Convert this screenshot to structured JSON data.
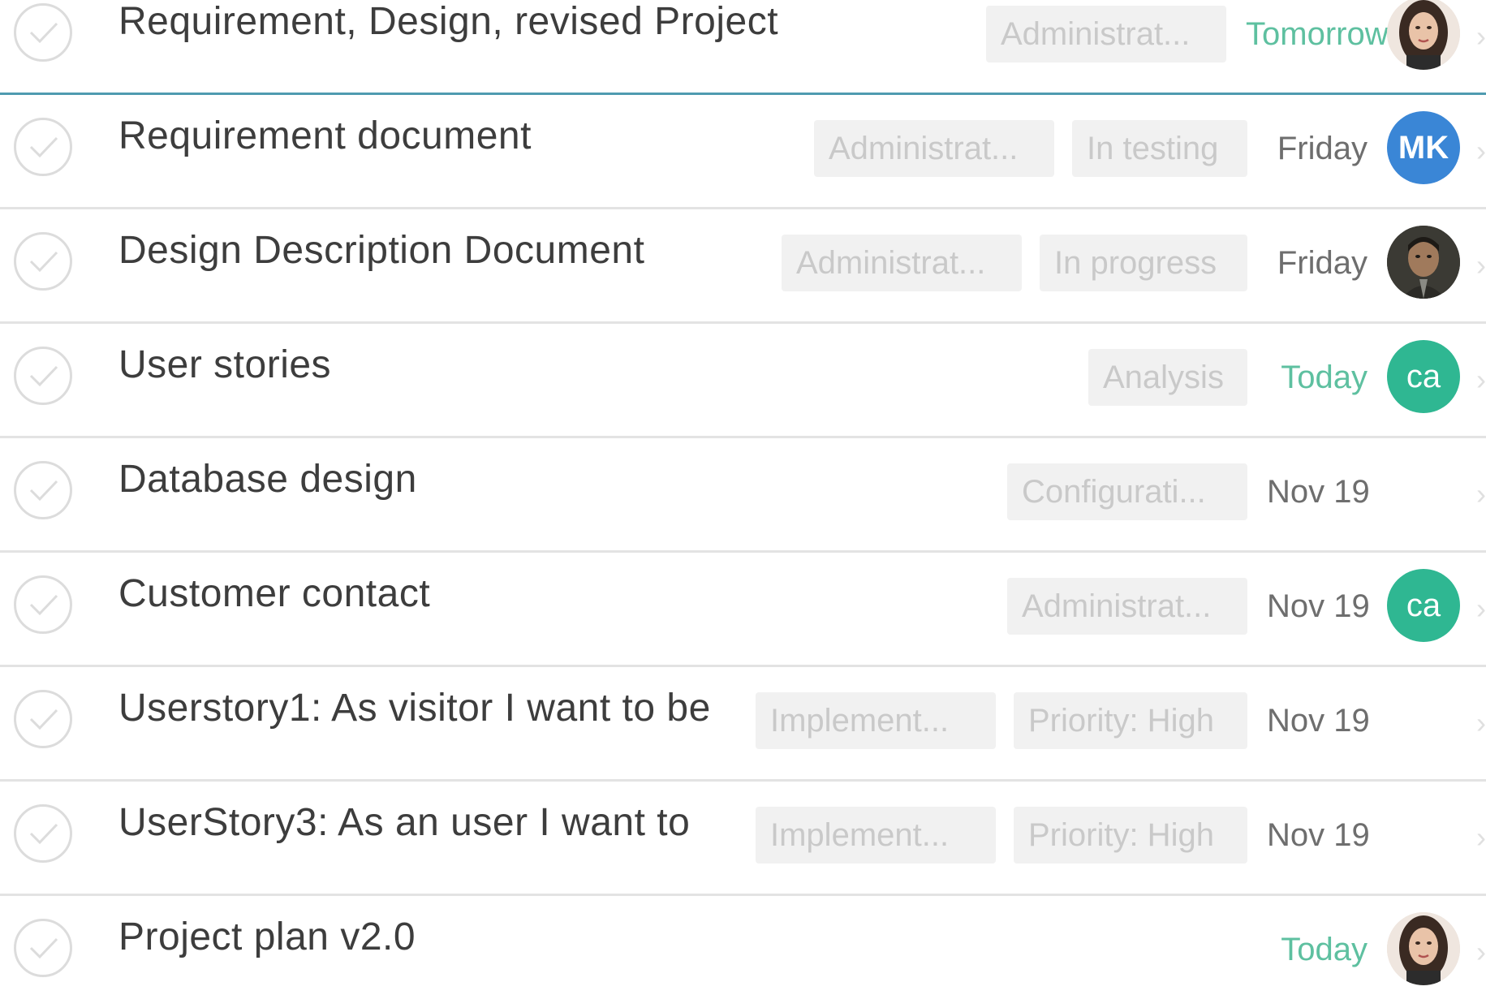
{
  "tasks": [
    {
      "title": "Requirement, Design, revised Project Plan",
      "tags": [
        "Administrat..."
      ],
      "due": "Tomorrow",
      "due_color": "green",
      "avatar": {
        "type": "photo-female",
        "initials": ""
      }
    },
    {
      "title": "Requirement document",
      "tags": [
        "Administrat...",
        "In testing"
      ],
      "due": "Friday",
      "due_color": "gray",
      "avatar": {
        "type": "initials",
        "initials": "MK",
        "color": "#3a86d6"
      }
    },
    {
      "title": "Design Description Document",
      "tags": [
        "Administrat...",
        "In progress"
      ],
      "due": "Friday",
      "due_color": "gray",
      "avatar": {
        "type": "photo-male",
        "initials": ""
      }
    },
    {
      "title": "User stories",
      "tags": [
        "Analysis"
      ],
      "due": "Today",
      "due_color": "green",
      "avatar": {
        "type": "initials",
        "initials": "ca",
        "color": "#2fb792"
      }
    },
    {
      "title": "Database design",
      "tags": [
        "Configurati..."
      ],
      "due": "Nov 19",
      "due_color": "gray",
      "avatar": null
    },
    {
      "title": "Customer contact",
      "tags": [
        "Administrat..."
      ],
      "due": "Nov 19",
      "due_color": "gray",
      "avatar": {
        "type": "initials",
        "initials": "ca",
        "color": "#2fb792"
      }
    },
    {
      "title": "Userstory1: As visitor I want to be",
      "tags": [
        "Implement...",
        "Priority: High"
      ],
      "due": "Nov 19",
      "due_color": "gray",
      "avatar": null
    },
    {
      "title": "UserStory3: As an user I want to",
      "tags": [
        "Implement...",
        "Priority: High"
      ],
      "due": "Nov 19",
      "due_color": "gray",
      "avatar": null
    },
    {
      "title": "Project plan v2.0",
      "tags": [],
      "due": "Today",
      "due_color": "green",
      "avatar": {
        "type": "photo-female",
        "initials": ""
      }
    }
  ],
  "colors": {
    "due_green": "#5ec0a0",
    "due_gray": "#6e6e6e",
    "tag_bg": "#f1f1f1",
    "tag_text": "#c9c9c9",
    "selected_border": "#4f9bb0"
  },
  "icons": {
    "check": "checkmark-circle-icon",
    "chevron": "chevron-right-icon"
  }
}
